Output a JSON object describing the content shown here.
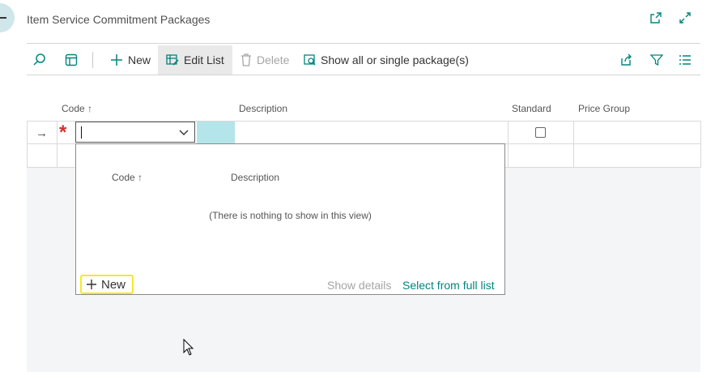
{
  "page": {
    "title": "Item Service Commitment Packages"
  },
  "header_icons": [
    "open-in-new-window-icon",
    "expand-icon"
  ],
  "toolbar": {
    "search_icon": "search-icon",
    "layout_icon": "layout-icon",
    "new_label": "New",
    "edit_list_label": "Edit List",
    "delete_label": "Delete",
    "show_label": "Show all or single package(s)",
    "right_icons": [
      "share-icon",
      "filter-icon",
      "list-view-icon"
    ]
  },
  "columns": {
    "code": "Code",
    "description": "Description",
    "standard": "Standard",
    "price_group": "Price Group"
  },
  "row": {
    "code_value": "",
    "description": "",
    "standard_checked": false,
    "price_group": ""
  },
  "dropdown": {
    "col_code": "Code",
    "col_description": "Description",
    "empty_message": "(There is nothing to show in this view)",
    "new_label": "New",
    "show_details": "Show details",
    "select_full": "Select from full list"
  },
  "colors": {
    "accent": "#00857d",
    "required": "#d32f2f",
    "highlight": "#f2ea2a",
    "selected_cell": "#b3e5ea"
  }
}
